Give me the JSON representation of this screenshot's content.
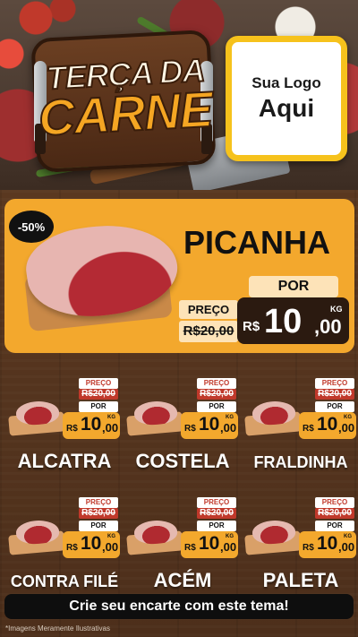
{
  "header": {
    "title_line1": "TERÇA DA",
    "title_line2": "CARNE",
    "logo_line1": "Sua Logo",
    "logo_line2": "Aqui"
  },
  "featured": {
    "discount": "-50%",
    "name": "PICANHA",
    "preco_label": "PREÇO",
    "old_price": "R$20,00",
    "por_label": "POR",
    "currency": "R$",
    "price_int": "10",
    "price_dec": ",00",
    "unit": "KG"
  },
  "products": [
    {
      "name": "ALCATRA",
      "preco_label": "PREÇO",
      "old_price": "R$20,00",
      "por_label": "POR",
      "currency": "R$",
      "price_int": "10",
      "price_dec": ",00",
      "unit": "KG"
    },
    {
      "name": "COSTELA",
      "preco_label": "PREÇO",
      "old_price": "R$20,00",
      "por_label": "POR",
      "currency": "R$",
      "price_int": "10",
      "price_dec": ",00",
      "unit": "KG"
    },
    {
      "name": "FRALDINHA",
      "preco_label": "PREÇO",
      "old_price": "R$20,00",
      "por_label": "POR",
      "currency": "R$",
      "price_int": "10",
      "price_dec": ",00",
      "unit": "KG"
    },
    {
      "name": "CONTRA FILÉ",
      "preco_label": "PREÇO",
      "old_price": "R$20,00",
      "por_label": "POR",
      "currency": "R$",
      "price_int": "10",
      "price_dec": ",00",
      "unit": "KG"
    },
    {
      "name": "ACÉM",
      "preco_label": "PREÇO",
      "old_price": "R$20,00",
      "por_label": "POR",
      "currency": "R$",
      "price_int": "10",
      "price_dec": ",00",
      "unit": "KG"
    },
    {
      "name": "PALETA",
      "preco_label": "PREÇO",
      "old_price": "R$20,00",
      "por_label": "POR",
      "currency": "R$",
      "price_int": "10",
      "price_dec": ",00",
      "unit": "KG"
    }
  ],
  "footer": {
    "cta": "Crie seu encarte com este tema!",
    "disclaimer": "*Imagens Meramente Ilustrativas"
  },
  "colors": {
    "accent_orange": "#f3a82d",
    "wood": "#4d2f1b",
    "price_dark": "#2b1a10",
    "tag_red": "#c0392b",
    "logo_border": "#f6c21c"
  }
}
